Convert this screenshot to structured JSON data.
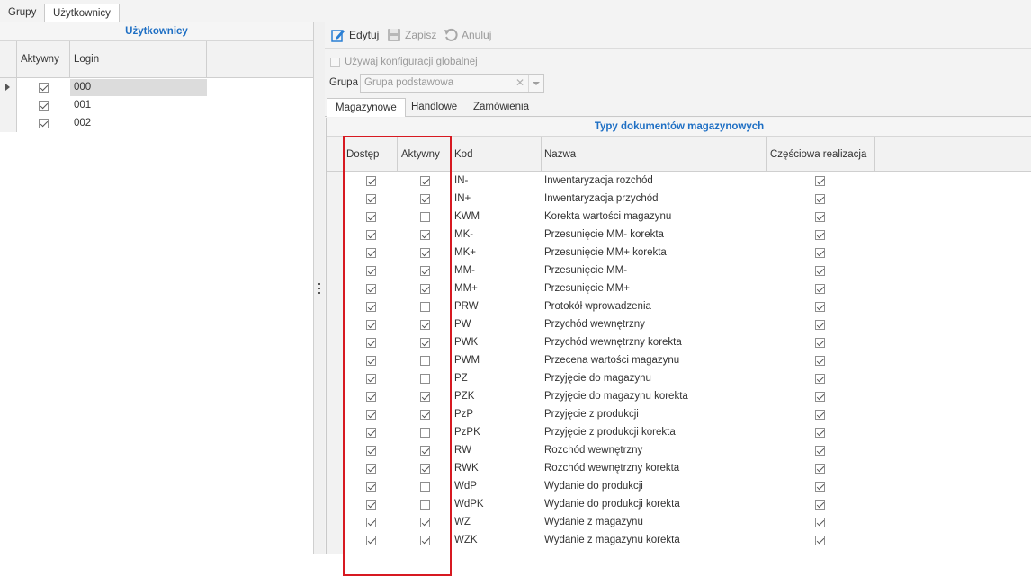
{
  "top_tabs": [
    {
      "label": "Grupy",
      "active": false
    },
    {
      "label": "Użytkownicy",
      "active": true
    }
  ],
  "users_panel": {
    "title": "Użytkownicy",
    "columns": [
      "Aktywny",
      "Login"
    ],
    "rows": [
      {
        "active": true,
        "login": "000",
        "selected": true
      },
      {
        "active": true,
        "login": "001",
        "selected": false
      },
      {
        "active": true,
        "login": "002",
        "selected": false
      }
    ]
  },
  "toolbar": {
    "edit_label": "Edytuj",
    "save_label": "Zapisz",
    "cancel_label": "Anuluj"
  },
  "global_config": {
    "label": "Używaj konfiguracji globalnej",
    "checked": false
  },
  "group": {
    "label": "Grupa",
    "value": "Grupa podstawowa"
  },
  "doc_tabs": [
    {
      "label": "Magazynowe",
      "active": true
    },
    {
      "label": "Handlowe",
      "active": false
    },
    {
      "label": "Zamówienia",
      "active": false
    }
  ],
  "doc_grid": {
    "title": "Typy dokumentów magazynowych",
    "columns": {
      "access": "Dostęp",
      "active": "Aktywny",
      "code": "Kod",
      "name": "Nazwa",
      "partial": "Częściowa realizacja"
    },
    "rows": [
      {
        "access": true,
        "active": true,
        "code": "IN-",
        "name": "Inwentaryzacja rozchód",
        "partial": true
      },
      {
        "access": true,
        "active": true,
        "code": "IN+",
        "name": "Inwentaryzacja przychód",
        "partial": true
      },
      {
        "access": true,
        "active": false,
        "code": "KWM",
        "name": "Korekta wartości magazynu",
        "partial": true
      },
      {
        "access": true,
        "active": true,
        "code": "MK-",
        "name": "Przesunięcie MM- korekta",
        "partial": true
      },
      {
        "access": true,
        "active": true,
        "code": "MK+",
        "name": "Przesunięcie MM+ korekta",
        "partial": true
      },
      {
        "access": true,
        "active": true,
        "code": "MM-",
        "name": "Przesunięcie MM-",
        "partial": true
      },
      {
        "access": true,
        "active": true,
        "code": "MM+",
        "name": "Przesunięcie MM+",
        "partial": true
      },
      {
        "access": true,
        "active": false,
        "code": "PRW",
        "name": "Protokół wprowadzenia",
        "partial": true
      },
      {
        "access": true,
        "active": true,
        "code": "PW",
        "name": "Przychód wewnętrzny",
        "partial": true
      },
      {
        "access": true,
        "active": true,
        "code": "PWK",
        "name": "Przychód wewnętrzny korekta",
        "partial": true
      },
      {
        "access": true,
        "active": false,
        "code": "PWM",
        "name": "Przecena wartości magazynu",
        "partial": true
      },
      {
        "access": true,
        "active": false,
        "code": "PZ",
        "name": "Przyjęcie do magazynu",
        "partial": true
      },
      {
        "access": true,
        "active": true,
        "code": "PZK",
        "name": "Przyjęcie do magazynu korekta",
        "partial": true
      },
      {
        "access": true,
        "active": true,
        "code": "PzP",
        "name": "Przyjęcie z produkcji",
        "partial": true
      },
      {
        "access": true,
        "active": false,
        "code": "PzPK",
        "name": "Przyjęcie z produkcji korekta",
        "partial": true
      },
      {
        "access": true,
        "active": true,
        "code": "RW",
        "name": "Rozchód wewnętrzny",
        "partial": true
      },
      {
        "access": true,
        "active": true,
        "code": "RWK",
        "name": "Rozchód wewnętrzny korekta",
        "partial": true
      },
      {
        "access": true,
        "active": false,
        "code": "WdP",
        "name": "Wydanie do produkcji",
        "partial": true
      },
      {
        "access": true,
        "active": false,
        "code": "WdPK",
        "name": "Wydanie do produkcji korekta",
        "partial": true
      },
      {
        "access": true,
        "active": true,
        "code": "WZ",
        "name": "Wydanie z magazynu",
        "partial": true
      },
      {
        "access": true,
        "active": true,
        "code": "WZK",
        "name": "Wydanie z magazynu korekta",
        "partial": true
      }
    ]
  },
  "colors": {
    "accent": "#1e6fc4",
    "highlight": "#d71921",
    "edit_icon": "#2a7fd4"
  },
  "icons": {
    "edit": "edit-icon",
    "save": "floppy-disk-icon",
    "cancel": "undo-icon",
    "row_indicator": "caret-right-icon",
    "clear": "clear-x-icon",
    "dropdown": "chevron-down-icon"
  }
}
